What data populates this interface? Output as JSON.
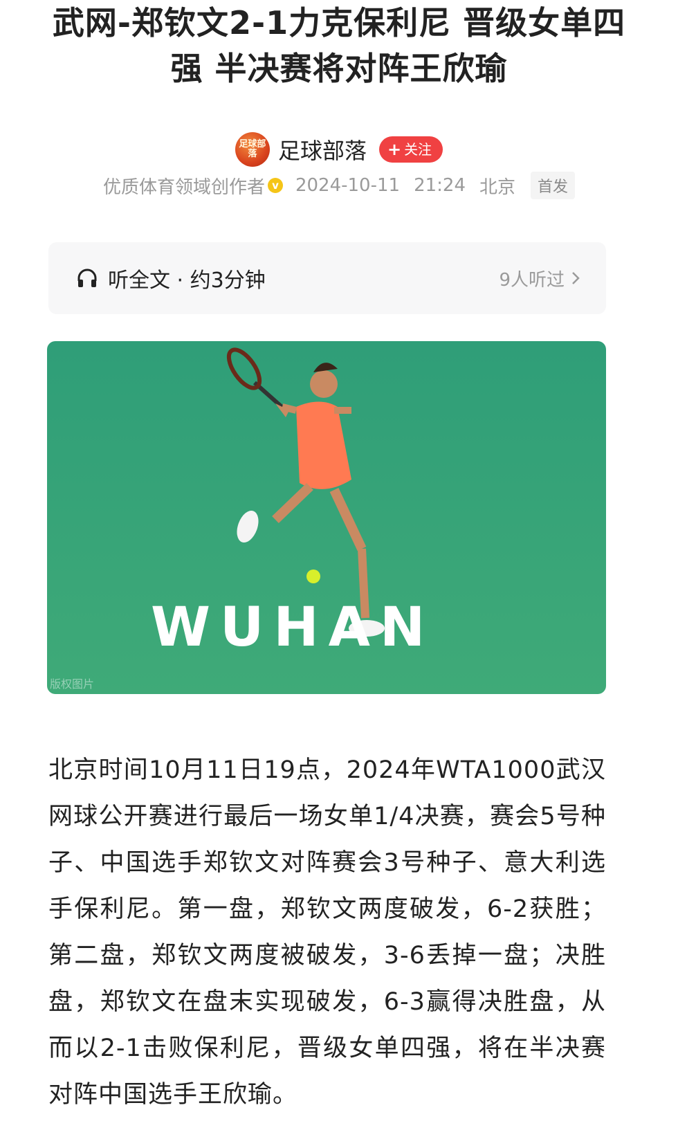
{
  "article": {
    "title": "武网-郑钦文2-1力克保利尼 晋级女单四强 半决赛将对阵王欣瑜",
    "author": {
      "avatar_text": "足球部落",
      "name": "足球部落",
      "follow_label": "关注",
      "follow_icon": "plus-icon"
    },
    "meta": {
      "creator_tag": "优质体育领域创作者",
      "verify_icon": "verified-badge-icon",
      "date": "2024-10-11",
      "time": "21:24",
      "location": "北京",
      "badge": "首发"
    },
    "listen": {
      "label": "听全文 · 约3分钟",
      "count": "9人听过",
      "icon": "headphones-icon"
    },
    "image": {
      "court_text": "WUHAN",
      "watermark": "版权图片"
    },
    "body": "北京时间10月11日19点，2024年WTA1000武汉网球公开赛进行最后一场女单1/4决赛，赛会5号种子、中国选手郑钦文对阵赛会3号种子、意大利选手保利尼。第一盘，郑钦文两度破发，6-2获胜；第二盘，郑钦文两度被破发，3-6丢掉一盘；决胜盘，郑钦文在盘末实现破发，6-3赢得决胜盘，从而以2-1击败保利尼，晋级女单四强，将在半决赛对阵中国选手王欣瑜。"
  },
  "colors": {
    "accent": "#f04142",
    "court_green": "#3aa87a",
    "text": "#222222",
    "muted": "#9a9a9a"
  }
}
